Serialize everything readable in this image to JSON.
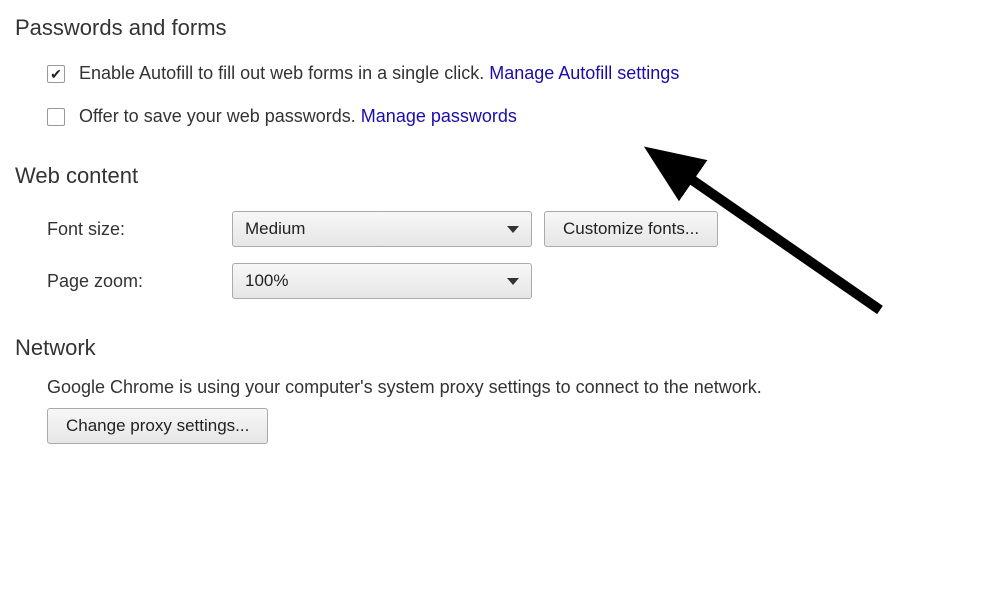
{
  "passwords_forms": {
    "heading": "Passwords and forms",
    "autofill": {
      "checked": true,
      "label": "Enable Autofill to fill out web forms in a single click. ",
      "link": "Manage Autofill settings"
    },
    "save_passwords": {
      "checked": false,
      "label": "Offer to save your web passwords. ",
      "link": "Manage passwords"
    }
  },
  "web_content": {
    "heading": "Web content",
    "font_size": {
      "label": "Font size:",
      "value": "Medium"
    },
    "customize_fonts_label": "Customize fonts...",
    "page_zoom": {
      "label": "Page zoom:",
      "value": "100%"
    }
  },
  "network": {
    "heading": "Network",
    "description": "Google Chrome is using your computer's system proxy settings to connect to the network.",
    "button_label": "Change proxy settings..."
  }
}
